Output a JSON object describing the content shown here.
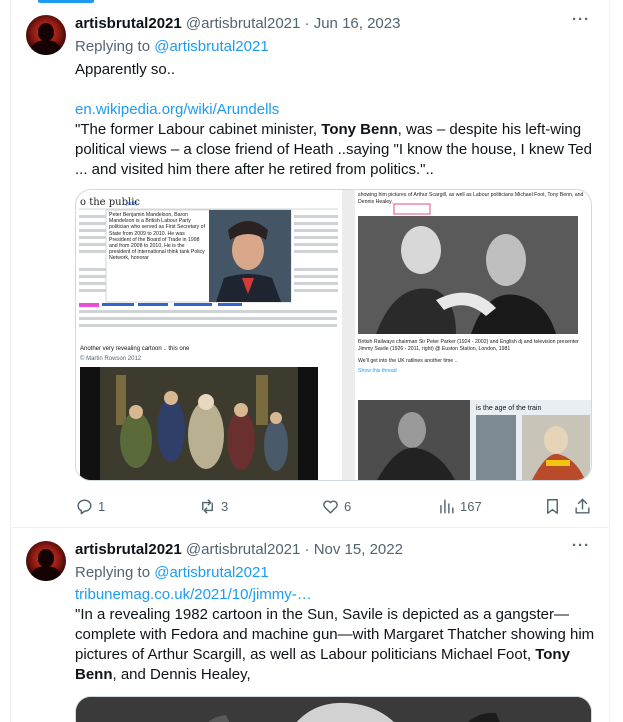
{
  "tweets": [
    {
      "name": "artisbrutal2021",
      "handle": "@artisbrutal2021",
      "separator": "·",
      "date": "Jun 16, 2023",
      "replying_prefix": "Replying to ",
      "replying_to": "@artisbrutal2021",
      "line1": "Apparently so..",
      "link": "en.wikipedia.org/wiki/Arundells",
      "quote_a": "\"The former Labour cabinet minister, ",
      "quote_bold": "Tony Benn",
      "quote_b": ",  was – despite his left-wing political views – a close friend of Heath  ..saying \"I know the house, I knew Ted ... and visited him there  after he retired from politics.\"..",
      "media": {
        "wiki_heading": "o the public",
        "wiki_edit": "[edit]",
        "popup_text": "Peter Benjamin Mandelson, Baron Mandelson is a British Labour Party politician who served as First Secretary of State from 2009 to 2010. He was President of the Board of Trade in 1998 and from 2008 to 2010. He is the president of international think tank Policy Network, honorar",
        "cartoon_caption_1": "Another very revealing cartoon .. this one",
        "cartoon_caption_2": "© Martin Rowson 2012",
        "right_top_text": "showing him pictures of Arthur Scargill, as well as Labour politicians Michael Foot, Tony Benn, and Dennis Healey,",
        "photo_caption": "British Railways chairman Sir Peter Parker (1924 - 2002) and English dj and television presenter Jimmy Savile (1926 - 2011, right) @ Euston Station, London, 1981",
        "ratlines_text": "We'll get into the UK ratlines another time ..",
        "show_thread": "Show this thread",
        "train_heading": "is the age of the train"
      },
      "actions": {
        "replies": "1",
        "retweets": "3",
        "likes": "6",
        "views": "167"
      }
    },
    {
      "name": "artisbrutal2021",
      "handle": "@artisbrutal2021",
      "separator": "·",
      "date": "Nov 15, 2022",
      "replying_prefix": "Replying to ",
      "replying_to": "@artisbrutal2021",
      "link": "tribunemag.co.uk/2021/10/jimmy-…",
      "quote_a": "\"In a revealing 1982 cartoon in the Sun, Savile is depicted as a gangster—complete with Fedora and machine gun—with Margaret Thatcher showing him pictures of Arthur Scargill, as well as Labour politicians Michael Foot, ",
      "quote_bold": "Tony Benn",
      "quote_b": ", and Dennis Healey,"
    }
  ],
  "colors": {
    "accent": "#1d9bf0",
    "text": "#0f1419",
    "muted": "#536471",
    "border": "#eff3f4"
  }
}
